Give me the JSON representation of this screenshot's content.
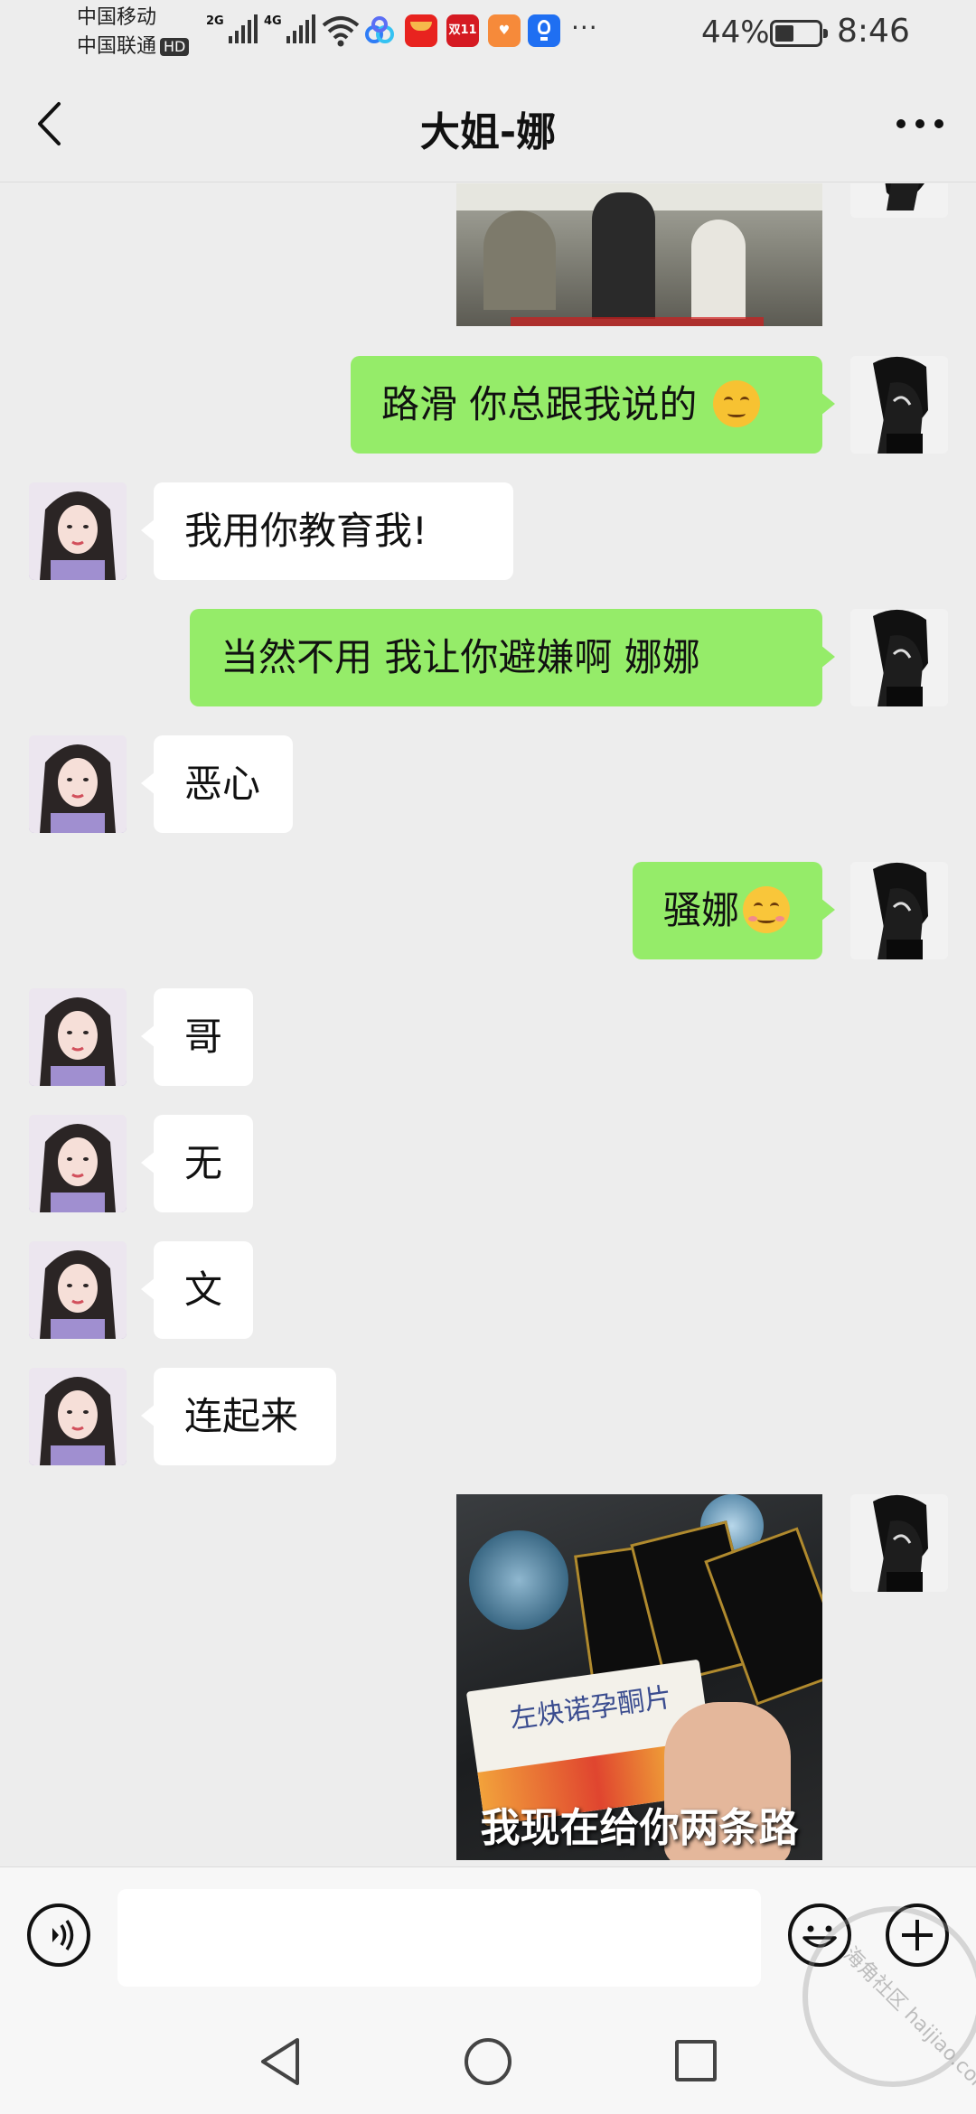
{
  "status_bar": {
    "carrier_1": "中国移动",
    "carrier_2": "中国联通",
    "hd_badge": "HD",
    "network_1": "2G",
    "network_2": "4G",
    "battery_percent": "44%",
    "battery_level": 0.44,
    "time": "8:46",
    "app_icons": [
      "baidu-netdisk-icon",
      "hongbao-icon",
      "double11-icon",
      "health-app-icon",
      "tips-icon"
    ],
    "double11_text": "双11",
    "overflow": "···"
  },
  "header": {
    "title": "大姐-娜",
    "back_icon": "chevron-left-icon",
    "more_icon": "more-dots-icon"
  },
  "messages": [
    {
      "side": "out",
      "type": "image"
    },
    {
      "side": "out",
      "type": "text",
      "text": "路滑  你总跟我说的 ",
      "emoji": "thinking-face"
    },
    {
      "side": "in",
      "type": "text",
      "text": "我用你教育我!"
    },
    {
      "side": "out",
      "type": "text",
      "text": "当然不用    我让你避嫌啊   娜娜"
    },
    {
      "side": "in",
      "type": "text",
      "text": "恶心"
    },
    {
      "side": "out",
      "type": "text",
      "text": "骚娜",
      "emoji": "shy-face"
    },
    {
      "side": "in",
      "type": "text",
      "text": "哥"
    },
    {
      "side": "in",
      "type": "text",
      "text": "无"
    },
    {
      "side": "in",
      "type": "text",
      "text": "文"
    },
    {
      "side": "in",
      "type": "text",
      "text": "连起来"
    },
    {
      "side": "out",
      "type": "image",
      "caption": "我现在给你两条路",
      "product_label": "左炔诺孕酮片"
    }
  ],
  "input_bar": {
    "voice_icon": "voice-icon",
    "emoji_icon": "emoji-icon",
    "plus_icon": "plus-icon",
    "placeholder": ""
  },
  "system_nav": {
    "back_icon": "triangle-back-icon",
    "home_icon": "circle-home-icon",
    "recent_icon": "square-recent-icon"
  },
  "watermark": {
    "text": "海角社区 haijiao.com"
  },
  "colors": {
    "outgoing_bubble": "#95ec69",
    "incoming_bubble": "#ffffff",
    "background": "#ededed"
  }
}
